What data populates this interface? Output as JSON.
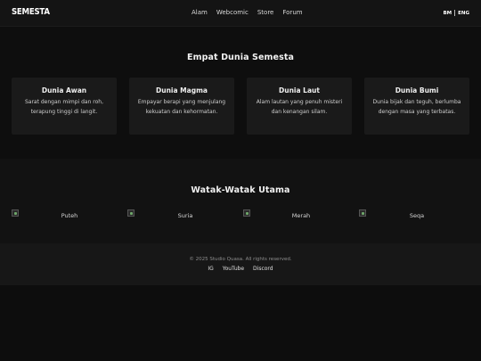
{
  "header": {
    "logo": "SEMESTA",
    "nav": [
      "Alam",
      "Webcomic",
      "Store",
      "Forum"
    ],
    "lang": [
      "BM",
      "ENG"
    ]
  },
  "worlds": {
    "heading": "Empat Dunia Semesta",
    "cards": [
      {
        "title": "Dunia Awan",
        "desc": "Sarat dengan mimpi dan roh, terapung tinggi di langit."
      },
      {
        "title": "Dunia Magma",
        "desc": "Empayar berapi yang menjulang kekuatan dan kehormatan."
      },
      {
        "title": "Dunia Laut",
        "desc": "Alam lautan yang penuh misteri dan kenangan silam."
      },
      {
        "title": "Dunia Bumi",
        "desc": "Dunia bijak dan teguh, berlumba dengan masa yang terbatas."
      }
    ]
  },
  "characters": {
    "heading": "Watak-Watak Utama",
    "items": [
      "Puteh",
      "Suria",
      "Merah",
      "Seqa"
    ]
  },
  "footer": {
    "copyright": "© 2025 Studio Quasa. All rights reserved.",
    "links": [
      "IG",
      "YouTube",
      "Discord"
    ]
  },
  "colors": {
    "background": "#0d0d0d",
    "card": "#1a1a1a",
    "footer": "#171717",
    "text": "#e9e9e9"
  },
  "icons": {
    "broken_image": "broken-image-icon"
  }
}
